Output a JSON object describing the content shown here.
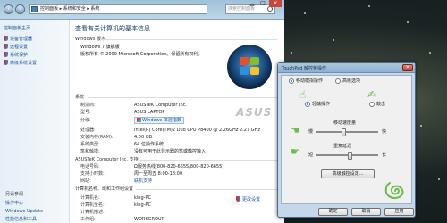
{
  "explorer": {
    "address": "控制面板 ▸ 系统和安全 ▸ 系统",
    "search_placeholder": "搜索控制面板",
    "minimize": "▁",
    "maximize": "□",
    "close": "✕"
  },
  "sidebar": {
    "links": [
      "控制面板主页",
      "设备管理器",
      "远程设置",
      "系统保护",
      "高级系统设置"
    ],
    "see_also_heading": "另请参阅",
    "see_also": [
      "操作中心",
      "Windows Update",
      "性能信息和工具"
    ]
  },
  "main": {
    "page_title": "查看有关计算机的基本信息",
    "edition_heading": "Windows 版本",
    "edition": "Windows 7 旗舰版",
    "copyright": "版权所有 © 2009 Microsoft Corporation。保留所有权利。",
    "system_heading": "系统",
    "manufacturer_label": "制造商:",
    "manufacturer": "ASUSTeK Computer Inc.",
    "model_label": "型号:",
    "model": "ASUS LAPTOP",
    "rating_label": "分级:",
    "rating": "Windows 体验指数",
    "processor_label": "处理器:",
    "processor": "Intel(R) Core(TM)2 Duo CPU     P8400 @ 2.26GHz   2.27 GHz",
    "ram_label": "安装内存(RAM):",
    "ram": "4.00 GB",
    "systype_label": "系统类型:",
    "systype": "64 位操作系统",
    "pen_label": "笔和触摸:",
    "pen": "没有可用于此显示器的笔或触控输入",
    "support_heading": "ASUSTeK Computer Inc. 支持",
    "phone_label": "电话号码:",
    "phone": "Ω服务热线(800-820-6655/800-820-6655)",
    "hours_label": "支持小时数:",
    "hours": "周一至周五 8:00-18:00",
    "website_label": "网站:",
    "website": "联机支持",
    "network_heading": "计算机名称、域和工作组设置",
    "computer_name_label": "计算机名:",
    "computer_name": "king-PC",
    "full_name_label": "计算机全名:",
    "full_name": "king-PC",
    "description_label": "计算机描述:",
    "workgroup_label": "工作组:",
    "workgroup": "WORKGROUP",
    "change_settings": "更改设置",
    "oem_logo": "ASUS"
  },
  "dialog": {
    "title": "TouchPad 触控板操作",
    "radio_tabs": [
      "移动模拟操作",
      "高级选项"
    ],
    "tap_label": "轻触操作",
    "drag_label": "敲击",
    "speed_label": "移动速度量",
    "speed_low": "慢",
    "speed_high": "快",
    "sensitivity_label": "重复延迟",
    "sens_low": "短",
    "sens_high": "长",
    "advanced_button": "高级触控设定...",
    "ok": "确定",
    "cancel": "取消",
    "apply": "应用",
    "speed_value": 0.45,
    "sensitivity_value": 0.55
  },
  "colors": {
    "link": "#1e5aa6",
    "accent_green": "#6dbb4a"
  }
}
